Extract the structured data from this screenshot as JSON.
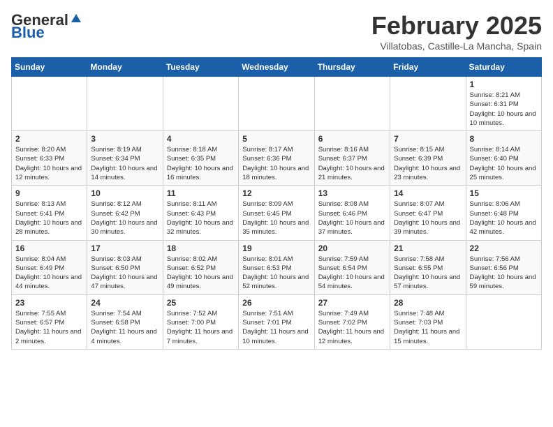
{
  "logo": {
    "general": "General",
    "blue": "Blue"
  },
  "header": {
    "month": "February 2025",
    "location": "Villatobas, Castille-La Mancha, Spain"
  },
  "weekdays": [
    "Sunday",
    "Monday",
    "Tuesday",
    "Wednesday",
    "Thursday",
    "Friday",
    "Saturday"
  ],
  "weeks": [
    [
      {
        "day": "",
        "info": ""
      },
      {
        "day": "",
        "info": ""
      },
      {
        "day": "",
        "info": ""
      },
      {
        "day": "",
        "info": ""
      },
      {
        "day": "",
        "info": ""
      },
      {
        "day": "",
        "info": ""
      },
      {
        "day": "1",
        "info": "Sunrise: 8:21 AM\nSunset: 6:31 PM\nDaylight: 10 hours and 10 minutes."
      }
    ],
    [
      {
        "day": "2",
        "info": "Sunrise: 8:20 AM\nSunset: 6:33 PM\nDaylight: 10 hours and 12 minutes."
      },
      {
        "day": "3",
        "info": "Sunrise: 8:19 AM\nSunset: 6:34 PM\nDaylight: 10 hours and 14 minutes."
      },
      {
        "day": "4",
        "info": "Sunrise: 8:18 AM\nSunset: 6:35 PM\nDaylight: 10 hours and 16 minutes."
      },
      {
        "day": "5",
        "info": "Sunrise: 8:17 AM\nSunset: 6:36 PM\nDaylight: 10 hours and 18 minutes."
      },
      {
        "day": "6",
        "info": "Sunrise: 8:16 AM\nSunset: 6:37 PM\nDaylight: 10 hours and 21 minutes."
      },
      {
        "day": "7",
        "info": "Sunrise: 8:15 AM\nSunset: 6:39 PM\nDaylight: 10 hours and 23 minutes."
      },
      {
        "day": "8",
        "info": "Sunrise: 8:14 AM\nSunset: 6:40 PM\nDaylight: 10 hours and 25 minutes."
      }
    ],
    [
      {
        "day": "9",
        "info": "Sunrise: 8:13 AM\nSunset: 6:41 PM\nDaylight: 10 hours and 28 minutes."
      },
      {
        "day": "10",
        "info": "Sunrise: 8:12 AM\nSunset: 6:42 PM\nDaylight: 10 hours and 30 minutes."
      },
      {
        "day": "11",
        "info": "Sunrise: 8:11 AM\nSunset: 6:43 PM\nDaylight: 10 hours and 32 minutes."
      },
      {
        "day": "12",
        "info": "Sunrise: 8:09 AM\nSunset: 6:45 PM\nDaylight: 10 hours and 35 minutes."
      },
      {
        "day": "13",
        "info": "Sunrise: 8:08 AM\nSunset: 6:46 PM\nDaylight: 10 hours and 37 minutes."
      },
      {
        "day": "14",
        "info": "Sunrise: 8:07 AM\nSunset: 6:47 PM\nDaylight: 10 hours and 39 minutes."
      },
      {
        "day": "15",
        "info": "Sunrise: 8:06 AM\nSunset: 6:48 PM\nDaylight: 10 hours and 42 minutes."
      }
    ],
    [
      {
        "day": "16",
        "info": "Sunrise: 8:04 AM\nSunset: 6:49 PM\nDaylight: 10 hours and 44 minutes."
      },
      {
        "day": "17",
        "info": "Sunrise: 8:03 AM\nSunset: 6:50 PM\nDaylight: 10 hours and 47 minutes."
      },
      {
        "day": "18",
        "info": "Sunrise: 8:02 AM\nSunset: 6:52 PM\nDaylight: 10 hours and 49 minutes."
      },
      {
        "day": "19",
        "info": "Sunrise: 8:01 AM\nSunset: 6:53 PM\nDaylight: 10 hours and 52 minutes."
      },
      {
        "day": "20",
        "info": "Sunrise: 7:59 AM\nSunset: 6:54 PM\nDaylight: 10 hours and 54 minutes."
      },
      {
        "day": "21",
        "info": "Sunrise: 7:58 AM\nSunset: 6:55 PM\nDaylight: 10 hours and 57 minutes."
      },
      {
        "day": "22",
        "info": "Sunrise: 7:56 AM\nSunset: 6:56 PM\nDaylight: 10 hours and 59 minutes."
      }
    ],
    [
      {
        "day": "23",
        "info": "Sunrise: 7:55 AM\nSunset: 6:57 PM\nDaylight: 11 hours and 2 minutes."
      },
      {
        "day": "24",
        "info": "Sunrise: 7:54 AM\nSunset: 6:58 PM\nDaylight: 11 hours and 4 minutes."
      },
      {
        "day": "25",
        "info": "Sunrise: 7:52 AM\nSunset: 7:00 PM\nDaylight: 11 hours and 7 minutes."
      },
      {
        "day": "26",
        "info": "Sunrise: 7:51 AM\nSunset: 7:01 PM\nDaylight: 11 hours and 10 minutes."
      },
      {
        "day": "27",
        "info": "Sunrise: 7:49 AM\nSunset: 7:02 PM\nDaylight: 11 hours and 12 minutes."
      },
      {
        "day": "28",
        "info": "Sunrise: 7:48 AM\nSunset: 7:03 PM\nDaylight: 11 hours and 15 minutes."
      },
      {
        "day": "",
        "info": ""
      }
    ]
  ]
}
